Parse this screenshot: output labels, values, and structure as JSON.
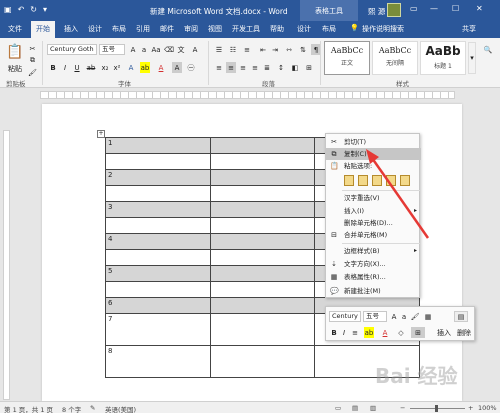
{
  "titlebar": {
    "doc_title": "新建 Microsoft Word 文档.docx - Word",
    "context_tab": "表格工具",
    "user": "熙 源"
  },
  "menubar": {
    "tabs": [
      "文件",
      "开始",
      "插入",
      "设计",
      "布局",
      "引用",
      "邮件",
      "审阅",
      "视图",
      "开发工具",
      "帮助",
      "设计",
      "布局"
    ],
    "tell_me": "操作说明搜索",
    "share": "共享"
  },
  "ribbon": {
    "paste_label": "粘贴",
    "clipboard_label": "剪贴板",
    "font_name": "Century Goth",
    "font_size": "五号",
    "font_label": "字体",
    "paragraph_label": "段落",
    "styles_label": "样式",
    "styles": [
      {
        "sample": "AaBbCc",
        "name": "正文"
      },
      {
        "sample": "AaBbCc",
        "name": "无间隔"
      },
      {
        "sample": "AaBb",
        "name": "标题 1"
      }
    ],
    "bold": "B",
    "italic": "I",
    "underline": "U"
  },
  "table": {
    "rows": [
      "1",
      "2",
      "3",
      "4",
      "5",
      "6",
      "7",
      "8"
    ],
    "handle": "+"
  },
  "context_menu": {
    "cut": "剪切(T)",
    "copy": "复制(C)",
    "paste_options": "粘贴选项:",
    "hanzi_reselect": "汉字重选(V)",
    "insert": "插入(I)",
    "delete_cells": "删除单元格(D)...",
    "merge_cells": "合并单元格(M)",
    "border_styles": "边框样式(B)",
    "text_direction": "文字方向(X)...",
    "table_properties": "表格属性(R)...",
    "new_comment": "新建批注(M)"
  },
  "mini_toolbar": {
    "font_name": "Century G",
    "font_size": "五号",
    "insert_label": "插入",
    "delete_label": "删除"
  },
  "statusbar": {
    "page": "第 1 页，共 1 页",
    "words": "8 个字",
    "language": "英语(美国)",
    "zoom": "100%"
  },
  "watermark": "Bai 经验",
  "colors": {
    "accent": "#2b579a",
    "arrow": "#e53935",
    "highlight": "#c6c6c6"
  }
}
